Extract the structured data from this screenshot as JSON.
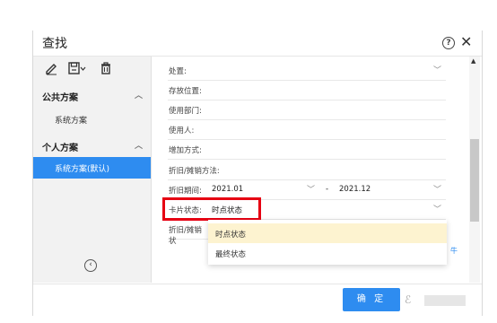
{
  "dialog": {
    "title": "查找",
    "help_icon": "?",
    "close_icon": "✕"
  },
  "sidebar": {
    "tools": [
      "edit-icon",
      "save-dropdown-icon",
      "delete-icon"
    ],
    "public_header": "公共方案",
    "public_items": [
      "系统方案"
    ],
    "personal_header": "个人方案",
    "personal_items": [
      "系统方案(默认)"
    ]
  },
  "form": {
    "rows": [
      {
        "label": "处置:",
        "value": ""
      },
      {
        "label": "存放位置:",
        "value": ""
      },
      {
        "label": "使用部门:",
        "value": ""
      },
      {
        "label": "使用人:",
        "value": ""
      },
      {
        "label": "增加方式:",
        "value": ""
      },
      {
        "label": "折旧/摊销方法:",
        "value": ""
      },
      {
        "label": "折旧期间:",
        "from": "2021.01",
        "dash": "-",
        "to": "2021.12"
      },
      {
        "label": "卡片状态:",
        "value": "时点状态"
      },
      {
        "label": "折旧/摊销状",
        "value": ""
      }
    ]
  },
  "dropdown": {
    "options": [
      "时点状态",
      "最终状态"
    ],
    "selected": "时点状态"
  },
  "partial_link": "牛",
  "footer": {
    "ok_label": "确 定"
  },
  "colors": {
    "accent": "#2e8cf0",
    "highlight_border": "#e60012",
    "selected_option_bg": "#fdf3d0"
  }
}
